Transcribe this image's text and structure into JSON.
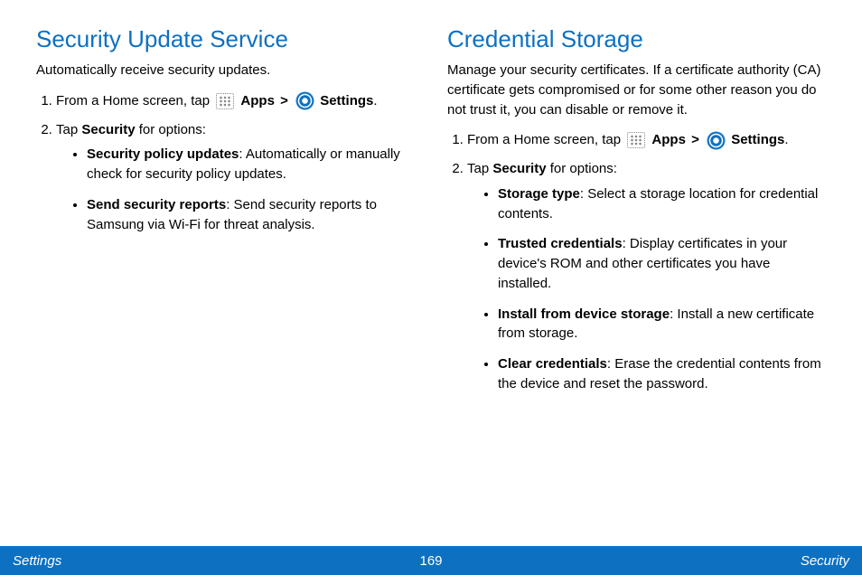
{
  "left": {
    "title": "Security Update Service",
    "intro": "Automatically receive security updates.",
    "steps": [
      {
        "prefix": "From a Home screen, tap ",
        "apps_label": "Apps",
        "gt": ">",
        "settings_label": "Settings",
        "suffix": "."
      },
      {
        "prefix": "Tap ",
        "bold": "Security",
        "suffix": " for options:",
        "bullets": [
          {
            "bold": "Security policy updates",
            "text": ": Automatically or manually check for security policy updates."
          },
          {
            "bold": "Send security reports",
            "text": ": Send security reports to Samsung via Wi-Fi for threat analysis."
          }
        ]
      }
    ]
  },
  "right": {
    "title": "Credential Storage",
    "intro": "Manage your security certificates. If a certificate authority (CA) certificate gets compromised or for some other reason you do not trust it, you can disable or remove it.",
    "steps": [
      {
        "prefix": "From a Home screen, tap ",
        "apps_label": "Apps",
        "gt": ">",
        "settings_label": "Settings",
        "suffix": "."
      },
      {
        "prefix": "Tap ",
        "bold": "Security",
        "suffix": " for options:",
        "bullets": [
          {
            "bold": "Storage type",
            "text": ": Select a storage location for credential contents."
          },
          {
            "bold": "Trusted credentials",
            "text": ": Display certificates in your device's ROM and other certificates you have installed."
          },
          {
            "bold": "Install from device storage",
            "text": ": Install a new certificate from storage."
          },
          {
            "bold": "Clear credentials",
            "text": ": Erase the credential contents from the device and reset the password."
          }
        ]
      }
    ]
  },
  "footer": {
    "left": "Settings",
    "center": "169",
    "right": "Security"
  }
}
